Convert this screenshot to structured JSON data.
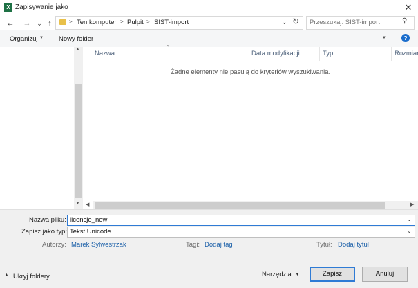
{
  "window": {
    "title": "Zapisywanie jako",
    "app_icon": "X"
  },
  "nav": {
    "back_icon": "←",
    "forward_icon": "→",
    "recent_icon": "⌄",
    "up_icon": "↑",
    "breadcrumbs": [
      "Ten komputer",
      "Pulpit",
      "SIST-import"
    ],
    "separator": ">",
    "search_placeholder": "Przeszukaj: SIST-import"
  },
  "toolbar": {
    "organize": "Organizuj",
    "new_folder": "Nowy folder"
  },
  "list": {
    "columns": [
      "Nazwa",
      "Data modyfikacji",
      "Typ",
      "Rozmiar"
    ],
    "empty_message": "Żadne elementy nie pasują do kryteriów wyszukiwania."
  },
  "form": {
    "filename_label": "Nazwa pliku:",
    "filename_value": "licencje_new",
    "filetype_label": "Zapisz jako typ:",
    "filetype_value": "Tekst Unicode",
    "authors_label": "Autorzy:",
    "authors_value": "Marek Sylwestrzak",
    "tags_label": "Tagi:",
    "tags_value": "Dodaj tag",
    "title_label": "Tytuł:",
    "title_value": "Dodaj tytuł"
  },
  "footer": {
    "hide_folders": "Ukryj foldery",
    "tools": "Narzędzia",
    "save": "Zapisz",
    "cancel": "Anuluj"
  },
  "colors": {
    "accent": "#2f7bd5",
    "link": "#1a5fa8",
    "excel": "#1e7145"
  }
}
